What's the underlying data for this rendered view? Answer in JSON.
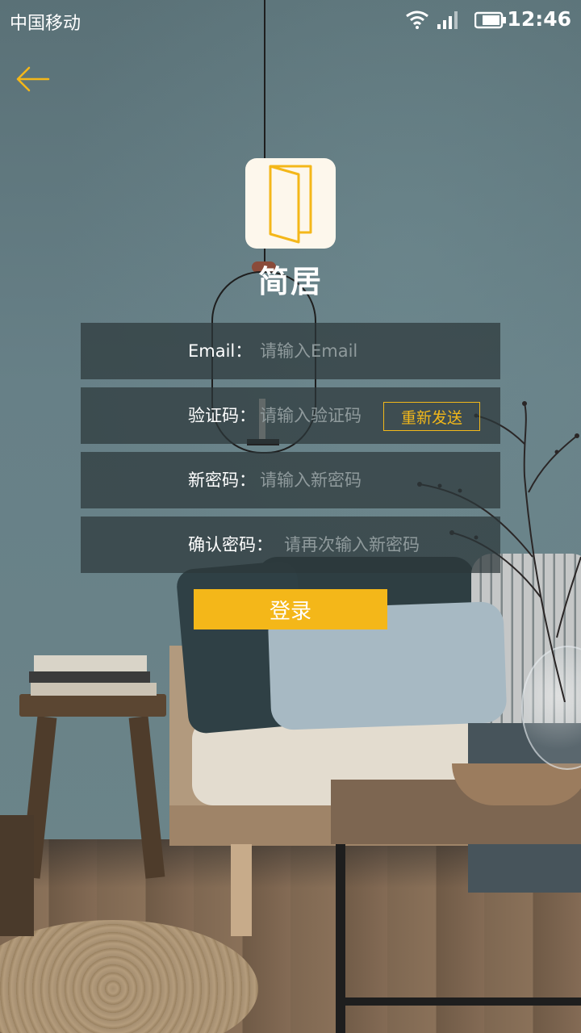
{
  "status_bar": {
    "carrier": "中国移动",
    "time": "12:46",
    "wifi_icon": "wifi-icon",
    "signal_icon": "signal-icon",
    "battery_icon": "battery-icon"
  },
  "header": {
    "back_icon": "back-arrow-icon"
  },
  "brand": {
    "logo_icon": "door-icon",
    "name": "简居",
    "accent_color": "#f4b719"
  },
  "form": {
    "email": {
      "label": "Email：",
      "placeholder": "请输入Email"
    },
    "code": {
      "label": "验证码：",
      "placeholder": "请输入验证码",
      "resend_label": "重新发送"
    },
    "new_password": {
      "label": "新密码：",
      "placeholder": "请输入新密码"
    },
    "confirm_password": {
      "label": "确认密码：",
      "placeholder": "请再次输入新密码"
    },
    "submit_label": "登录"
  }
}
